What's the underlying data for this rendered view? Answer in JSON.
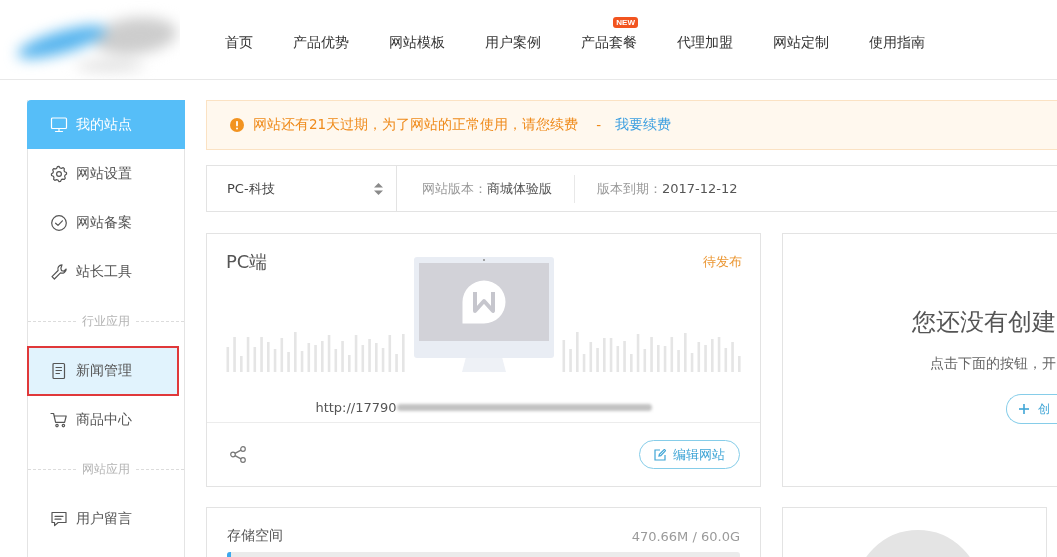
{
  "header": {
    "nav": [
      {
        "label": "首页"
      },
      {
        "label": "产品优势"
      },
      {
        "label": "网站模板"
      },
      {
        "label": "用户案例"
      },
      {
        "label": "产品套餐",
        "badge": "NEW"
      },
      {
        "label": "代理加盟"
      },
      {
        "label": "网站定制"
      },
      {
        "label": "使用指南"
      }
    ]
  },
  "sidebar": {
    "items": [
      {
        "kind": "item",
        "label": "我的站点",
        "selected": true,
        "hovered": false,
        "outlined": false
      },
      {
        "kind": "item",
        "label": "网站设置",
        "selected": false,
        "hovered": false,
        "outlined": false
      },
      {
        "kind": "item",
        "label": "网站备案",
        "selected": false,
        "hovered": false,
        "outlined": false
      },
      {
        "kind": "item",
        "label": "站长工具",
        "selected": false,
        "hovered": false,
        "outlined": false
      },
      {
        "kind": "group",
        "label": "行业应用"
      },
      {
        "kind": "item",
        "label": "新闻管理",
        "selected": false,
        "hovered": true,
        "outlined": true
      },
      {
        "kind": "item",
        "label": "商品中心",
        "selected": false,
        "hovered": false,
        "outlined": false
      },
      {
        "kind": "group",
        "label": "网站应用"
      },
      {
        "kind": "item",
        "label": "用户留言",
        "selected": false,
        "hovered": false,
        "outlined": false
      }
    ]
  },
  "alert": {
    "message": "网站还有21天过期，为了网站的正常使用，请您续费",
    "separator": "-",
    "link": "我要续费"
  },
  "site_bar": {
    "site_select": {
      "value": "PC-科技"
    },
    "fields": [
      {
        "label": "网站版本：",
        "value": "商城体验版"
      },
      {
        "label": "版本到期：",
        "value": "2017-12-12"
      }
    ]
  },
  "pc_card": {
    "title": "PC端",
    "status": "待发布",
    "url": "http://17790",
    "button": "编辑网站"
  },
  "empty_card": {
    "title": "您还没有创建",
    "subtitle": "点击下面的按钮，开",
    "button": "创"
  },
  "storage_card": {
    "label": "存储空间",
    "reading": "470.66M / 60.0G",
    "level": 0.008
  }
}
